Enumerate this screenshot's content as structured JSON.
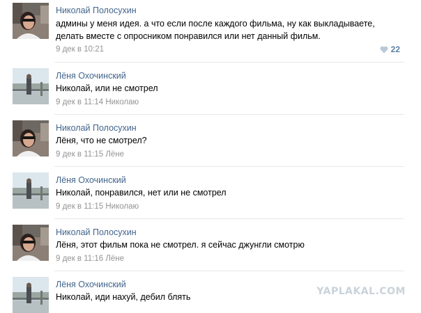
{
  "comments": [
    {
      "author": "Николай Полосухин",
      "text": "админы у меня идея. а что если после каждого фильма, ну как выкладываете, делать вместе с опросником понравился или нет данный фильм.",
      "date": "9 дек в 10:21",
      "reply_to": "",
      "likes": "22",
      "avatar": "woman-in-sunglasses"
    },
    {
      "author": "Лёня Охочинский",
      "text": "Николай, или не смотрел",
      "date": "9 дек в 11:14",
      "reply_to": "Николаю",
      "avatar": "man-on-bridge"
    },
    {
      "author": "Николай Полосухин",
      "text": "Лёня, что не смотрел?",
      "date": "9 дек в 11:15",
      "reply_to": "Лёне",
      "avatar": "woman-in-sunglasses"
    },
    {
      "author": "Лёня Охочинский",
      "text": "Николай, понравился, нет или не смотрел",
      "date": "9 дек в 11:15",
      "reply_to": "Николаю",
      "avatar": "man-on-bridge"
    },
    {
      "author": "Николай Полосухин",
      "text": "Лёня, этот фильм пока не смотрел. я сейчас джунгли смотрю",
      "date": "9 дек в 11:16",
      "reply_to": "Лёне",
      "avatar": "woman-in-sunglasses"
    },
    {
      "author": "Лёня Охочинский",
      "text": "Николай, иди нахуй, дебил блять",
      "date": "",
      "reply_to": "",
      "avatar": "man-on-bridge"
    }
  ],
  "watermark": "YAPLAKAL.COM",
  "colors": {
    "author_link": "#42648b",
    "meta": "#939393",
    "divider": "#e7e8ec",
    "like": "#5b7fa6"
  }
}
